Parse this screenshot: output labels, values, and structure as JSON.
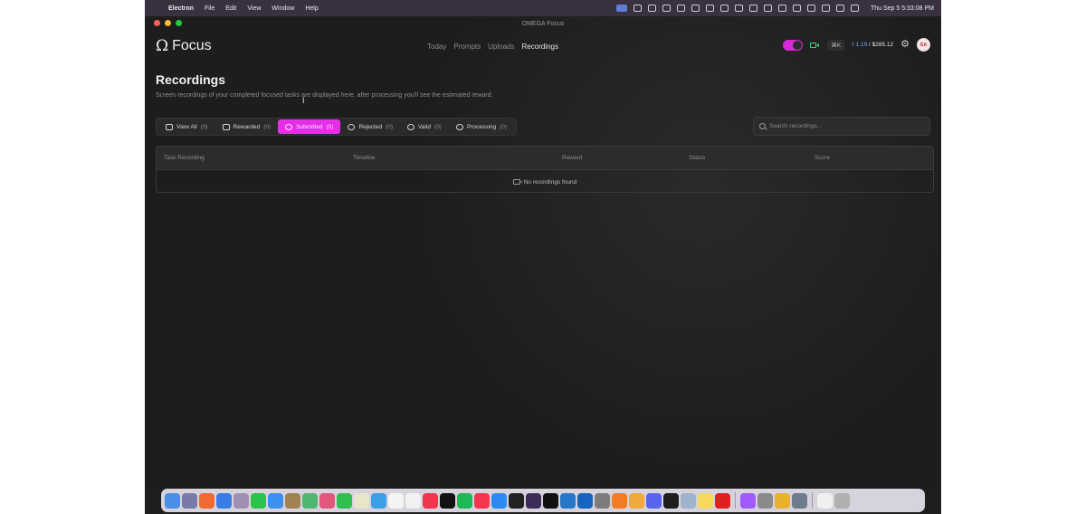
{
  "menubar": {
    "app_name": "Electron",
    "menus": [
      "File",
      "Edit",
      "View",
      "Window",
      "Help"
    ],
    "clock": "Thu Sep 5  5:33:08 PM"
  },
  "window": {
    "title": "OMEGA Focus"
  },
  "header": {
    "logo_symbol": "Ω",
    "logo_text": "Focus",
    "nav": [
      "Today",
      "Prompts",
      "Uploads",
      "Recordings"
    ],
    "active_nav": "Recordings",
    "shortcut": "⌘K",
    "balance_tao": "τ 1.19",
    "balance_usd": " / $285.12",
    "avatar_initials": "SA",
    "toggle_on": true
  },
  "page": {
    "title": "Recordings",
    "subtitle": "Screen recordings of your completed focused tasks are displayed here, after processing you'll see the estimated reward."
  },
  "filters": [
    {
      "label": "View All",
      "count": "(0)",
      "icon": "film-icon",
      "active": false
    },
    {
      "label": "Rewarded",
      "count": "(0)",
      "icon": "coins-icon",
      "active": false
    },
    {
      "label": "Submitted",
      "count": "(0)",
      "icon": "cloud-upload-icon",
      "active": true
    },
    {
      "label": "Rejected",
      "count": "(0)",
      "icon": "cloud-x-icon",
      "active": false
    },
    {
      "label": "Valid",
      "count": "(0)",
      "icon": "cloud-check-icon",
      "active": false
    },
    {
      "label": "Processing",
      "count": "(0)",
      "icon": "spinner-icon",
      "active": false
    }
  ],
  "search": {
    "placeholder": "Search recordings..."
  },
  "table": {
    "columns": [
      "Task Recording",
      "Timeline",
      "Reward",
      "Status",
      "Score"
    ],
    "empty_message": "No recordings found"
  },
  "colors": {
    "accent": "#e42fe6",
    "background": "#1e1e1e",
    "camera_green": "#3fd37a",
    "tao_blue": "#6ea8ff"
  }
}
